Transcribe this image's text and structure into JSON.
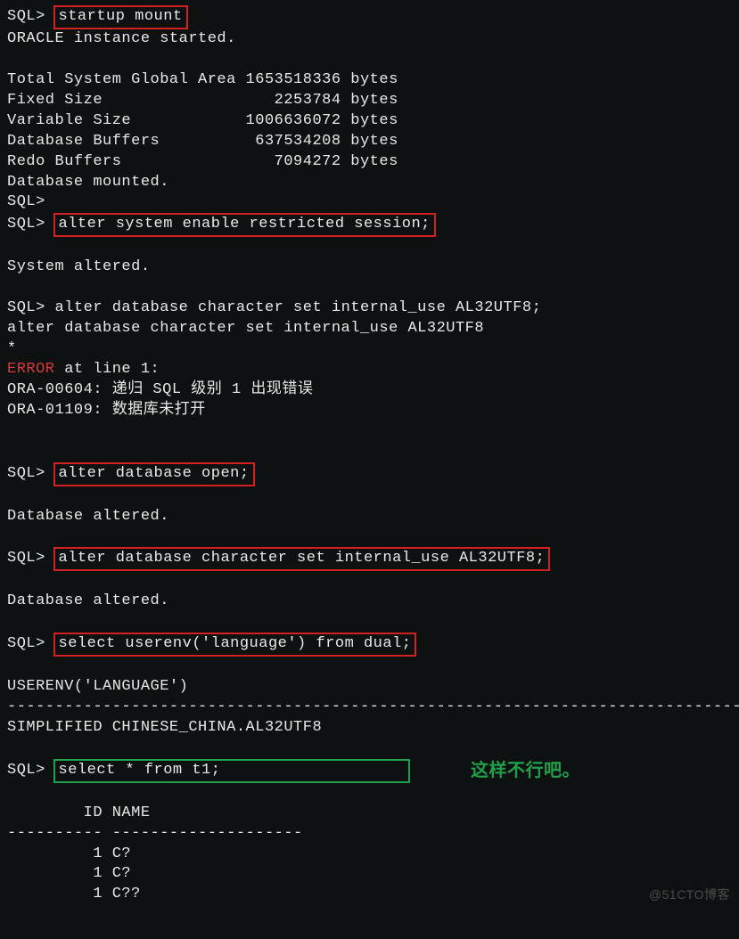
{
  "prompt": "SQL>",
  "cmd1": "startup mount",
  "started": "ORACLE instance started.",
  "sga_hdr": "Total System Global Area 1653518336 bytes",
  "fixed": "Fixed Size                  2253784 bytes",
  "var": "Variable Size            1006636072 bytes",
  "dbbuf": "Database Buffers          637534208 bytes",
  "redo": "Redo Buffers                7094272 bytes",
  "mounted": "Database mounted.",
  "cmd2": "alter system enable restricted session;",
  "sys_alt": "System altered.",
  "cmd3": "alter database character set internal_use AL32UTF8;",
  "echo3": "alter database character set internal_use AL32UTF8",
  "star": "*",
  "error_kw": "ERROR",
  "error_rest": " at line 1:",
  "ora1": "ORA-00604: 递归 SQL 级别 1 出现错误",
  "ora2": "ORA-01109: 数据库未打开",
  "cmd4": "alter database open;",
  "db_alt": "Database altered.",
  "cmd5": "alter database character set internal_use AL32UTF8;",
  "cmd6": "select userenv('language') from dual;",
  "col_hdr": "USERENV('LANGUAGE')",
  "dash1": "--------------------------------------------------------------------------------",
  "lang_val": "SIMPLIFIED CHINESE_CHINA.AL32UTF8",
  "cmd7": "select * from t1;",
  "hint": "这样不行吧。",
  "tbl_hdr": "        ID NAME",
  "dash2": "---------- --------------------",
  "row1": "         1 C?",
  "row2": "         1 C?",
  "row3": "         1 C??",
  "watermark": "@51CTO博客"
}
